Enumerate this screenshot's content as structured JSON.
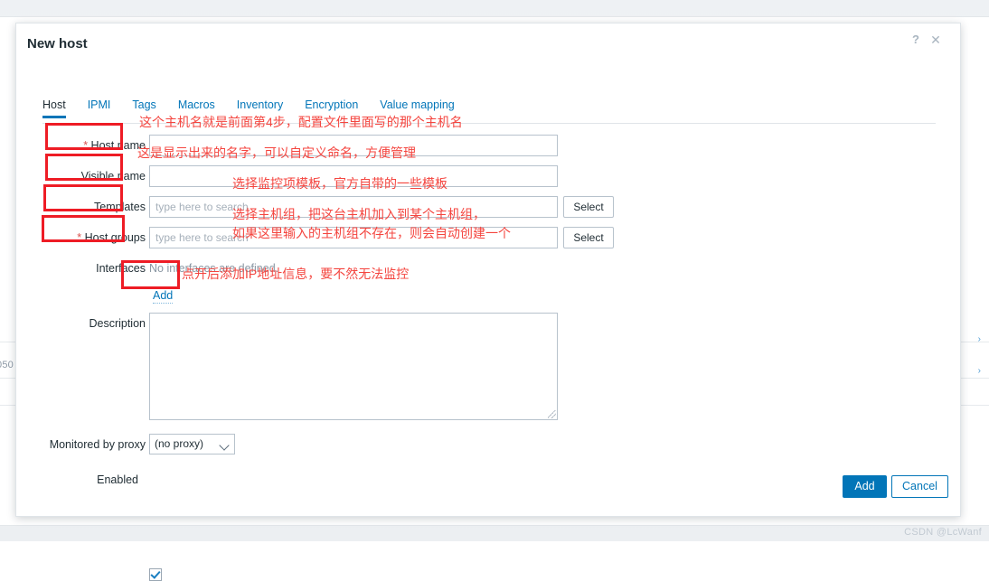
{
  "dialog": {
    "title": "New host",
    "help_icon": "?",
    "close_icon": "✕"
  },
  "tabs": [
    {
      "label": "Host",
      "active": true
    },
    {
      "label": "IPMI",
      "active": false
    },
    {
      "label": "Tags",
      "active": false
    },
    {
      "label": "Macros",
      "active": false
    },
    {
      "label": "Inventory",
      "active": false
    },
    {
      "label": "Encryption",
      "active": false
    },
    {
      "label": "Value mapping",
      "active": false
    }
  ],
  "form": {
    "host_name": {
      "label": "Host name",
      "required": true,
      "value": "",
      "placeholder": ""
    },
    "visible_name": {
      "label": "Visible name",
      "required": false,
      "value": "",
      "placeholder": ""
    },
    "templates": {
      "label": "Templates",
      "required": false,
      "value": "",
      "placeholder": "type here to search",
      "select_label": "Select"
    },
    "host_groups": {
      "label": "Host groups",
      "required": true,
      "value": "",
      "placeholder": "type here to search",
      "select_label": "Select"
    },
    "interfaces": {
      "label": "Interfaces",
      "empty_text": "No interfaces are defined.",
      "add_label": "Add"
    },
    "description": {
      "label": "Description",
      "value": ""
    },
    "monitored_by_proxy": {
      "label": "Monitored by proxy",
      "value": "(no proxy)"
    },
    "enabled": {
      "label": "Enabled",
      "checked": true
    }
  },
  "footer": {
    "add_label": "Add",
    "cancel_label": "Cancel"
  },
  "annotations": [
    {
      "text": "这个主机名就是前面第4步，配置文件里面写的那个主机名"
    },
    {
      "text": "这是显示出来的名字，可以自定义命名，方便管理"
    },
    {
      "text": "选择监控项模板，官方自带的一些模板"
    },
    {
      "text": "选择主机组，把这台主机加入到某个主机组，"
    },
    {
      "text": "如果这里输入的主机组不存在，则会自动创建一个"
    },
    {
      "text": "点开后添加IP地址信息，要不然无法监控"
    }
  ],
  "background": {
    "partial_number": "050"
  },
  "watermark": "CSDN @LcWanf",
  "colors": {
    "accent": "#0275b8",
    "annotation_red": "#f4453f",
    "annotation_box": "#ee1c25",
    "required_star": "#d9534f"
  }
}
